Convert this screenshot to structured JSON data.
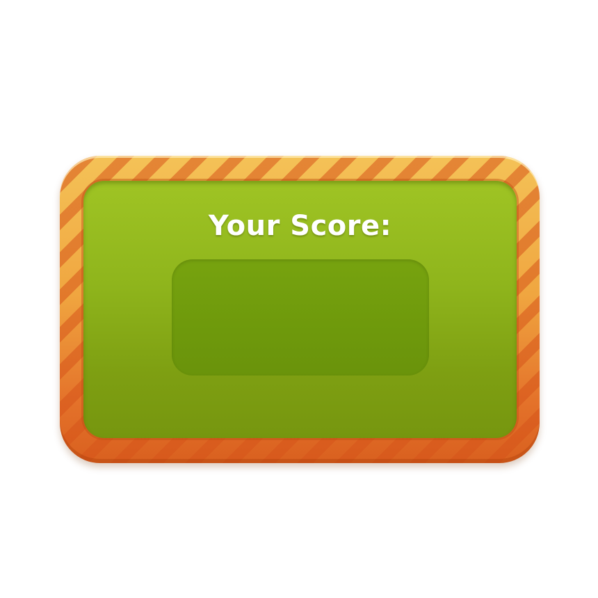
{
  "score_panel": {
    "title": "Your Score:",
    "score_value": "",
    "colors": {
      "frame_light": "#f4c257",
      "frame_dark": "#d9601f",
      "stripe": "#d6541a",
      "panel_top": "#9fc424",
      "panel_bottom": "#76960f",
      "score_box": "#6f9a0c",
      "title_text": "#ffffff"
    }
  }
}
